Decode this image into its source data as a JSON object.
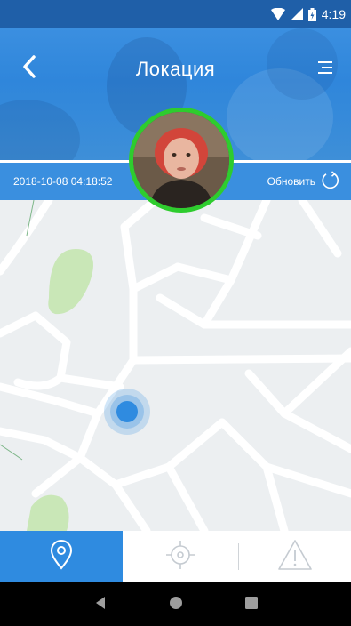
{
  "status_bar": {
    "time": "4:19"
  },
  "header": {
    "title": "Локация"
  },
  "info": {
    "timestamp": "2018-10-08 04:18:52",
    "refresh_label": "Обновить"
  },
  "tabs": {
    "active": "location",
    "items": [
      "location",
      "target",
      "alert"
    ]
  },
  "colors": {
    "accent": "#2f8be0",
    "avatar_ring": "#2ecc2e",
    "map_background": "#eceff1",
    "location_dot": "#2f8be0"
  },
  "icons": {
    "back": "chevron-left-icon",
    "menu": "list-menu-icon",
    "refresh": "refresh-icon",
    "location": "map-pin-icon",
    "target": "crosshair-icon",
    "alert": "warning-triangle-icon"
  }
}
